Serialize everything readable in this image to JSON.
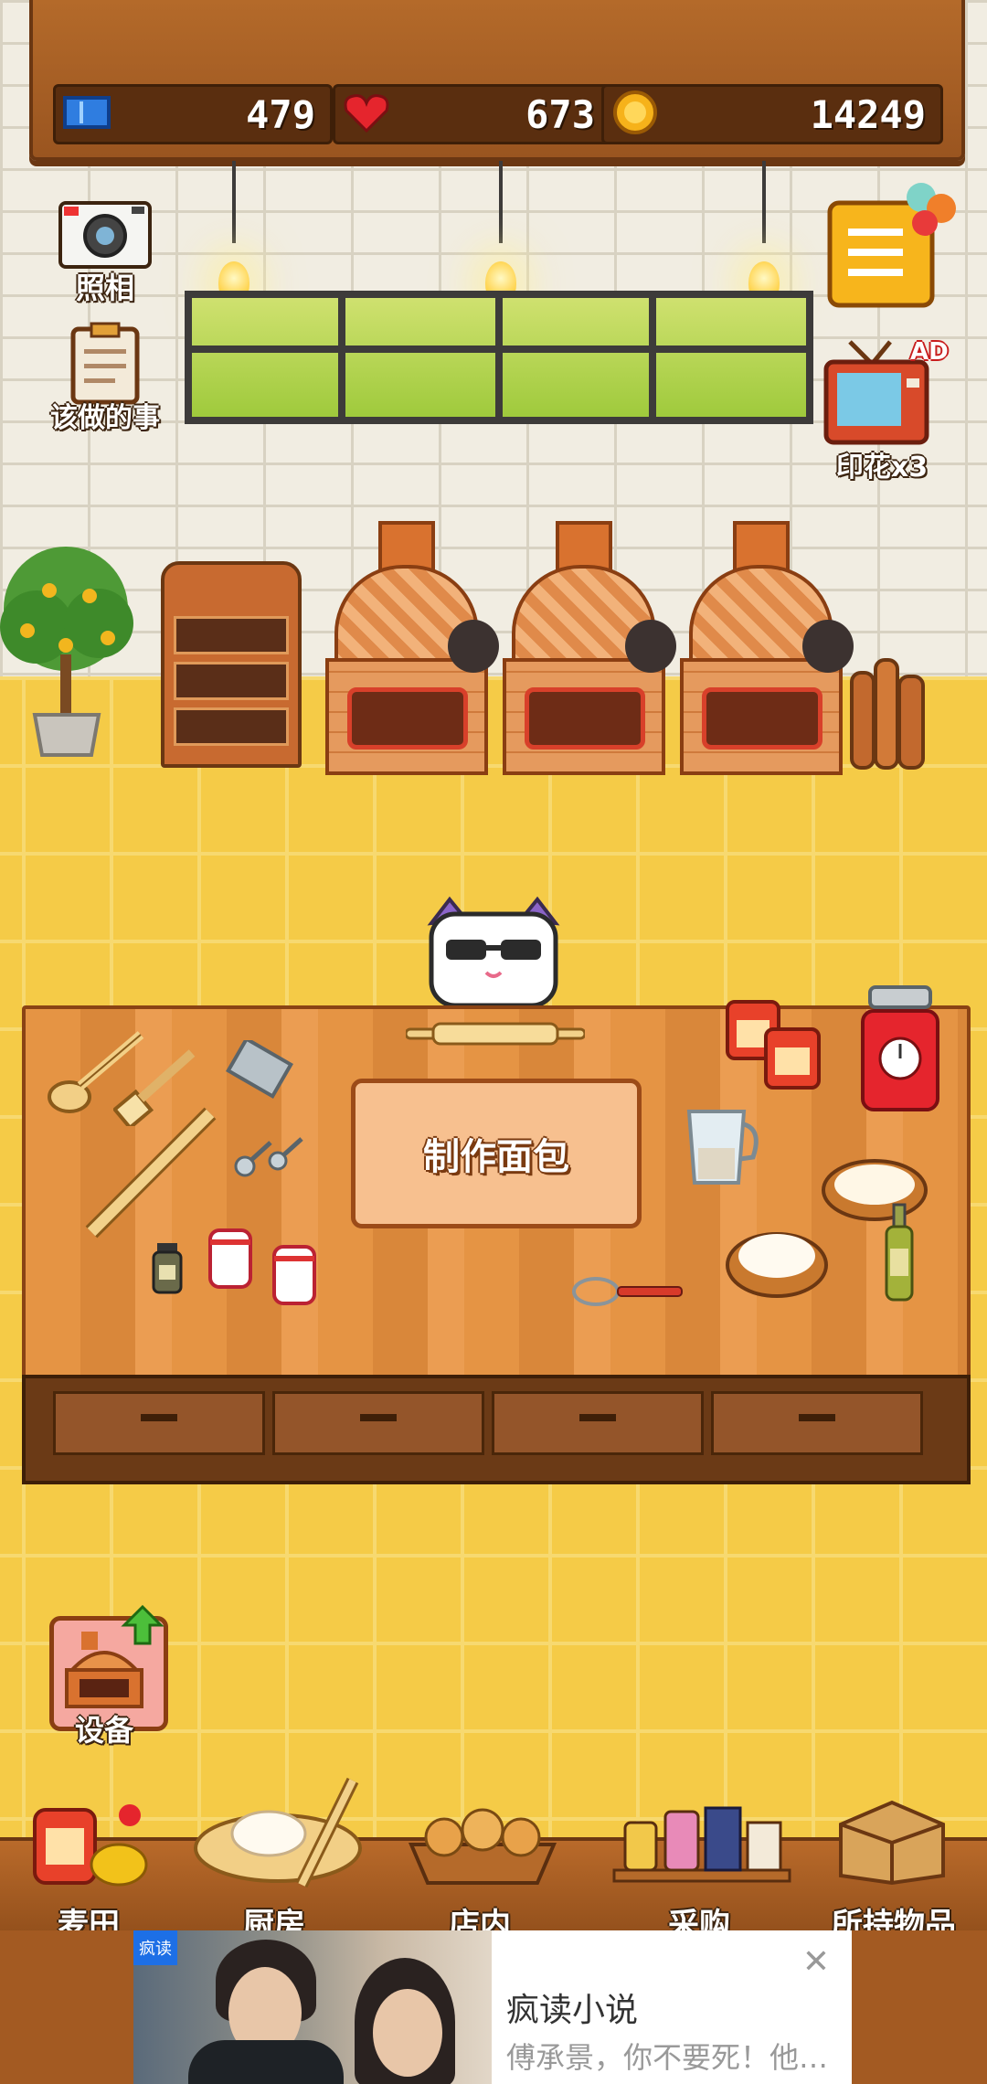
{
  "hud": {
    "tickets": "479",
    "hearts": "673",
    "coins": "14249"
  },
  "left_menu": {
    "photo_label": "照相",
    "todo_label": "该做的事"
  },
  "right_menu": {
    "stamp_label": "印花x3",
    "ad_badge": "AD"
  },
  "counter": {
    "make_bread_label": "制作面包"
  },
  "equipment": {
    "label": "设备"
  },
  "bottom_nav": {
    "items": [
      {
        "label": "麦田"
      },
      {
        "label": "厨房"
      },
      {
        "label": "店内"
      },
      {
        "label": "采购"
      },
      {
        "label": "所持物品"
      }
    ]
  },
  "ad": {
    "tag": "疯读",
    "title": "疯读小说",
    "subtitle": "傅承景，你不要死！他紧..."
  },
  "colors": {
    "wood": "#a35a22",
    "floor": "#f5cb47",
    "wall": "#f1ede2"
  }
}
